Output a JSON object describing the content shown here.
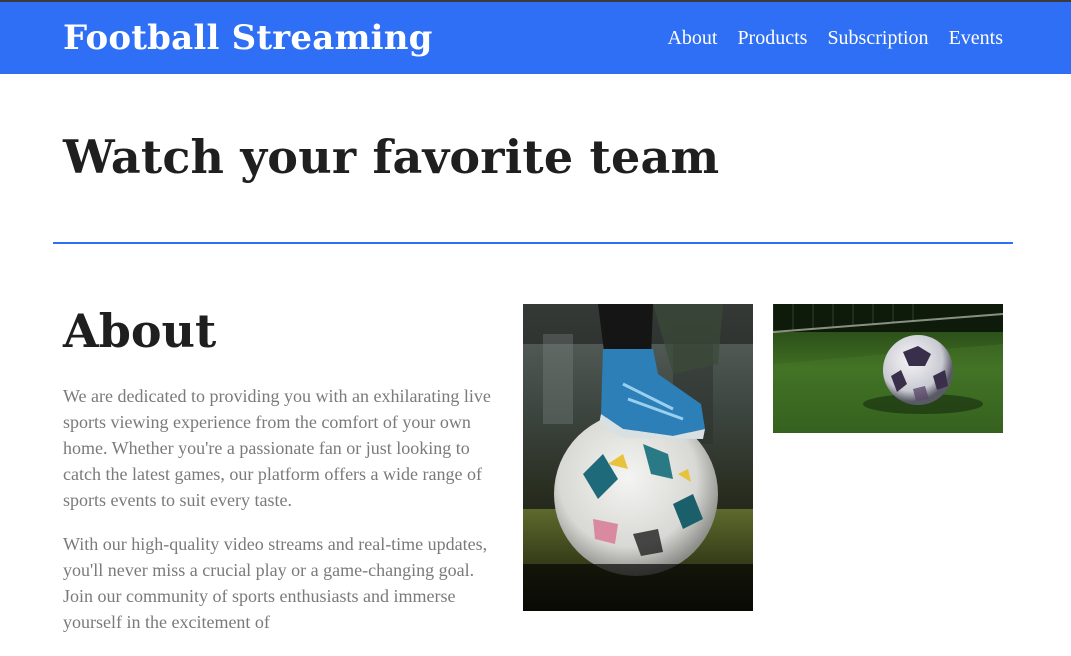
{
  "header": {
    "brand": "Football Streaming",
    "nav": [
      "About",
      "Products",
      "Subscription",
      "Events"
    ]
  },
  "hero": {
    "title": "Watch your favorite team"
  },
  "about": {
    "heading": "About",
    "paragraphs": [
      "We are dedicated to providing you with an exhilarating live sports viewing experience from the comfort of your own home. Whether you're a passionate fan or just looking to catch the latest games, our platform offers a wide range of sports events to suit every taste.",
      "With our high-quality video streams and real-time updates, you'll never miss a crucial play or a game-changing goal. Join our community of sports enthusiasts and immerse yourself in the excitement of"
    ]
  },
  "colors": {
    "accent": "#2e6ff5",
    "heading": "#1f1f1f",
    "body_text": "#7a7a7a"
  }
}
